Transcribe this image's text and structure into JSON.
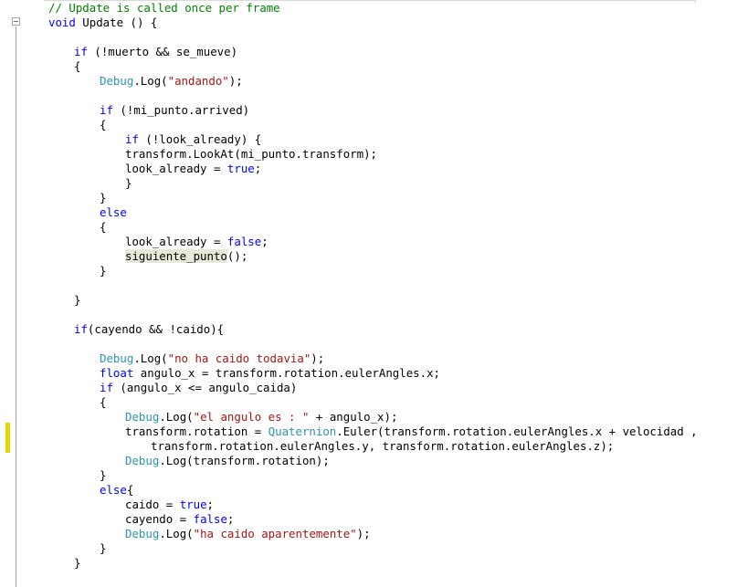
{
  "editor": {
    "colors": {
      "keyword": "#0000ff",
      "string": "#a31515",
      "comment": "#008000",
      "type": "#2b91af",
      "plain": "#000000",
      "change_marker": "#e8d600",
      "reference_highlight": "#e8e8d8"
    },
    "gutter": {
      "fold_icon": "collapse-box-icon",
      "change_indicator": "modified-line-marker"
    },
    "lines": [
      {
        "indent": 0,
        "tokens": [
          {
            "t": "// Update is called once per frame",
            "c": "cmt"
          }
        ]
      },
      {
        "indent": 0,
        "tokens": [
          {
            "t": "void",
            "c": "kw"
          },
          {
            "t": " Update () {"
          }
        ]
      },
      {
        "indent": 0,
        "tokens": []
      },
      {
        "indent": 1,
        "tokens": [
          {
            "t": "if",
            "c": "kw"
          },
          {
            "t": " (!muerto && se_mueve)"
          }
        ]
      },
      {
        "indent": 1,
        "tokens": [
          {
            "t": "{"
          }
        ]
      },
      {
        "indent": 2,
        "tokens": [
          {
            "t": "Debug",
            "c": "typ"
          },
          {
            "t": ".Log("
          },
          {
            "t": "\"andando\"",
            "c": "str"
          },
          {
            "t": ");"
          }
        ]
      },
      {
        "indent": 0,
        "tokens": []
      },
      {
        "indent": 2,
        "tokens": [
          {
            "t": "if",
            "c": "kw"
          },
          {
            "t": " (!mi_punto.arrived)"
          }
        ]
      },
      {
        "indent": 2,
        "tokens": [
          {
            "t": "{"
          }
        ]
      },
      {
        "indent": 3,
        "tokens": [
          {
            "t": "if",
            "c": "kw"
          },
          {
            "t": " (!look_already) {"
          }
        ]
      },
      {
        "indent": 3,
        "tokens": [
          {
            "t": "transform.LookAt(mi_punto.transform);"
          }
        ]
      },
      {
        "indent": 3,
        "tokens": [
          {
            "t": "look_already = "
          },
          {
            "t": "true",
            "c": "kw"
          },
          {
            "t": ";"
          }
        ]
      },
      {
        "indent": 3,
        "tokens": [
          {
            "t": "}"
          }
        ]
      },
      {
        "indent": 2,
        "tokens": [
          {
            "t": "}"
          }
        ]
      },
      {
        "indent": 2,
        "tokens": [
          {
            "t": "else",
            "c": "kw"
          }
        ]
      },
      {
        "indent": 2,
        "tokens": [
          {
            "t": "{"
          }
        ]
      },
      {
        "indent": 3,
        "tokens": [
          {
            "t": "look_already = "
          },
          {
            "t": "false",
            "c": "kw"
          },
          {
            "t": ";"
          }
        ]
      },
      {
        "indent": 3,
        "tokens": [
          {
            "t": "siguiente_punto",
            "c": "ref"
          },
          {
            "t": "();"
          }
        ]
      },
      {
        "indent": 2,
        "tokens": [
          {
            "t": "}"
          }
        ]
      },
      {
        "indent": 0,
        "tokens": []
      },
      {
        "indent": 1,
        "tokens": [
          {
            "t": "}"
          }
        ]
      },
      {
        "indent": 0,
        "tokens": []
      },
      {
        "indent": 1,
        "tokens": [
          {
            "t": "if",
            "c": "kw"
          },
          {
            "t": "(cayendo && !caido){"
          }
        ]
      },
      {
        "indent": 0,
        "tokens": []
      },
      {
        "indent": 2,
        "tokens": [
          {
            "t": "Debug",
            "c": "typ"
          },
          {
            "t": ".Log("
          },
          {
            "t": "\"no ha caido todavia\"",
            "c": "str"
          },
          {
            "t": ");"
          }
        ]
      },
      {
        "indent": 2,
        "tokens": [
          {
            "t": "float",
            "c": "kw"
          },
          {
            "t": " angulo_x = transform.rotation.eulerAngles.x;"
          }
        ]
      },
      {
        "indent": 2,
        "tokens": [
          {
            "t": "if",
            "c": "kw"
          },
          {
            "t": " (angulo_x <= angulo_caida)"
          }
        ]
      },
      {
        "indent": 2,
        "tokens": [
          {
            "t": "{"
          }
        ]
      },
      {
        "indent": 3,
        "tokens": [
          {
            "t": "Debug",
            "c": "typ"
          },
          {
            "t": ".Log("
          },
          {
            "t": "\"el angulo es : \"",
            "c": "str"
          },
          {
            "t": " + angulo_x);"
          }
        ]
      },
      {
        "indent": 3,
        "tokens": [
          {
            "t": "transform.rotation = "
          },
          {
            "t": "Quaternion",
            "c": "typ"
          },
          {
            "t": ".Euler(transform.rotation.eulerAngles.x + velocidad ,"
          }
        ]
      },
      {
        "indent": 4,
        "tokens": [
          {
            "t": "transform.rotation.eulerAngles.y, transform.rotation.eulerAngles.z);"
          }
        ]
      },
      {
        "indent": 3,
        "tokens": [
          {
            "t": "Debug",
            "c": "typ"
          },
          {
            "t": ".Log(transform.rotation);"
          }
        ]
      },
      {
        "indent": 2,
        "tokens": [
          {
            "t": "}"
          }
        ]
      },
      {
        "indent": 2,
        "tokens": [
          {
            "t": "else",
            "c": "kw"
          },
          {
            "t": "{"
          }
        ]
      },
      {
        "indent": 3,
        "tokens": [
          {
            "t": "caido = "
          },
          {
            "t": "true",
            "c": "kw"
          },
          {
            "t": ";"
          }
        ]
      },
      {
        "indent": 3,
        "tokens": [
          {
            "t": "cayendo = "
          },
          {
            "t": "false",
            "c": "kw"
          },
          {
            "t": ";"
          }
        ]
      },
      {
        "indent": 3,
        "tokens": [
          {
            "t": "Debug",
            "c": "typ"
          },
          {
            "t": ".Log("
          },
          {
            "t": "\"ha caido aparentemente\"",
            "c": "str"
          },
          {
            "t": ");"
          }
        ]
      },
      {
        "indent": 2,
        "tokens": [
          {
            "t": "}"
          }
        ]
      },
      {
        "indent": 1,
        "tokens": [
          {
            "t": "}"
          }
        ]
      }
    ]
  }
}
